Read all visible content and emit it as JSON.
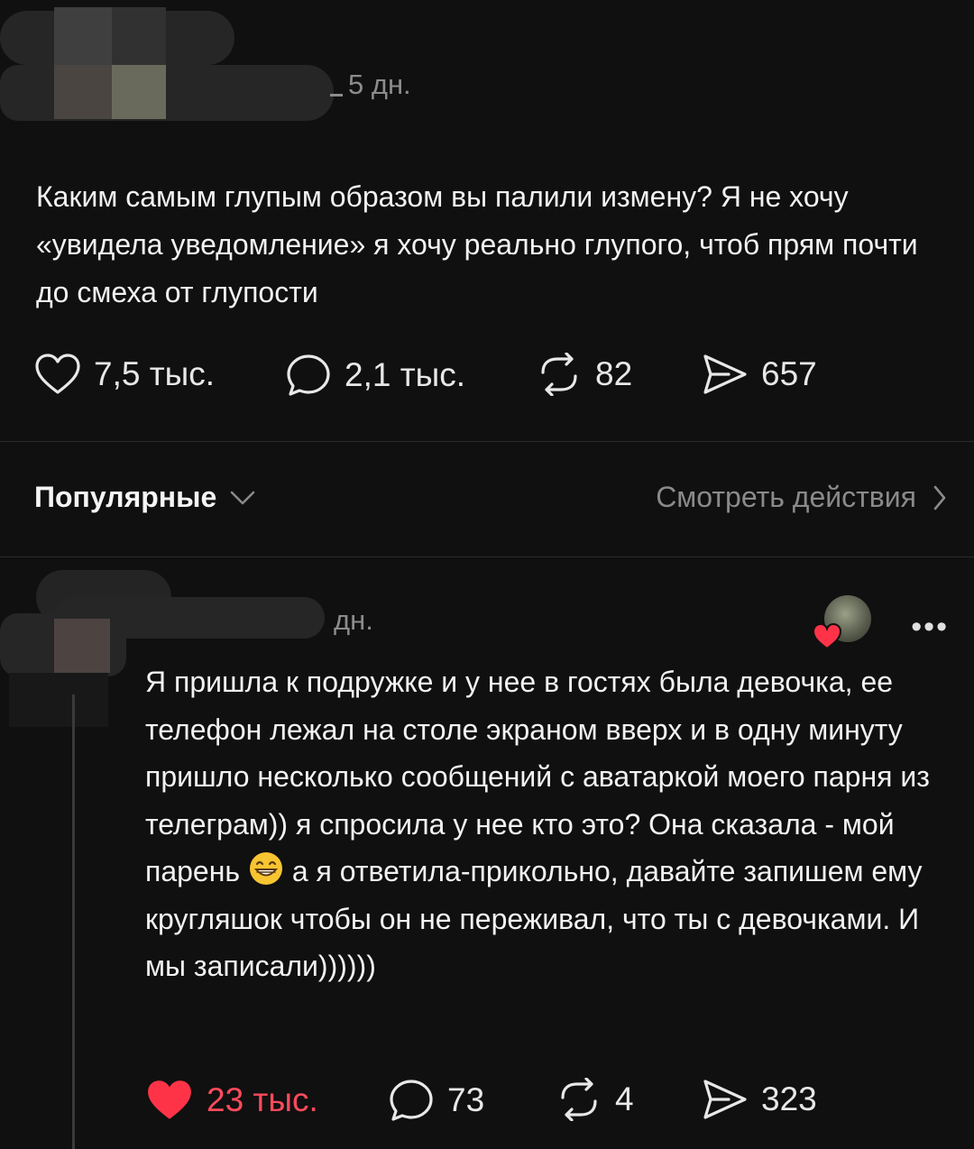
{
  "post": {
    "time": "5 дн.",
    "text": "Каким самым глупым образом вы палили измену? Я не хочу «увидела уведомление» я хочу реально глупого, чтоб прям почти до смеха от глупости",
    "likes": "7,5 тыс.",
    "comments": "2,1 тыс.",
    "reposts": "82",
    "shares": "657"
  },
  "sort": {
    "label": "Популярные",
    "view_activity": "Смотреть действия"
  },
  "reply": {
    "time": "дн.",
    "text_before_emoji": "Я пришла к подружке и у нее в гостях была девочка, ее телефон лежал на столе экраном вверх и в одну минуту пришло несколько сообщений с аватаркой моего парня из телеграм)) я спросила у нее кто это? Она сказала - мой парень ",
    "text_after_emoji": " а я ответила-прикольно, давайте запишем ему кругляшок чтобы он не переживал, что ты с девочками. И мы записали))))))",
    "more": "•••",
    "likes": "23 тыс.",
    "comments": "73",
    "reposts": "4",
    "shares": "323",
    "liked": true
  },
  "colors": {
    "background": "#101010",
    "like_active": "#ff4a5c",
    "muted": "#8c8c8c"
  },
  "icons": [
    "heart-icon",
    "comment-icon",
    "repost-icon",
    "share-icon",
    "chevron-down-icon",
    "chevron-right-icon",
    "more-icon",
    "grinning-emoji-icon"
  ]
}
